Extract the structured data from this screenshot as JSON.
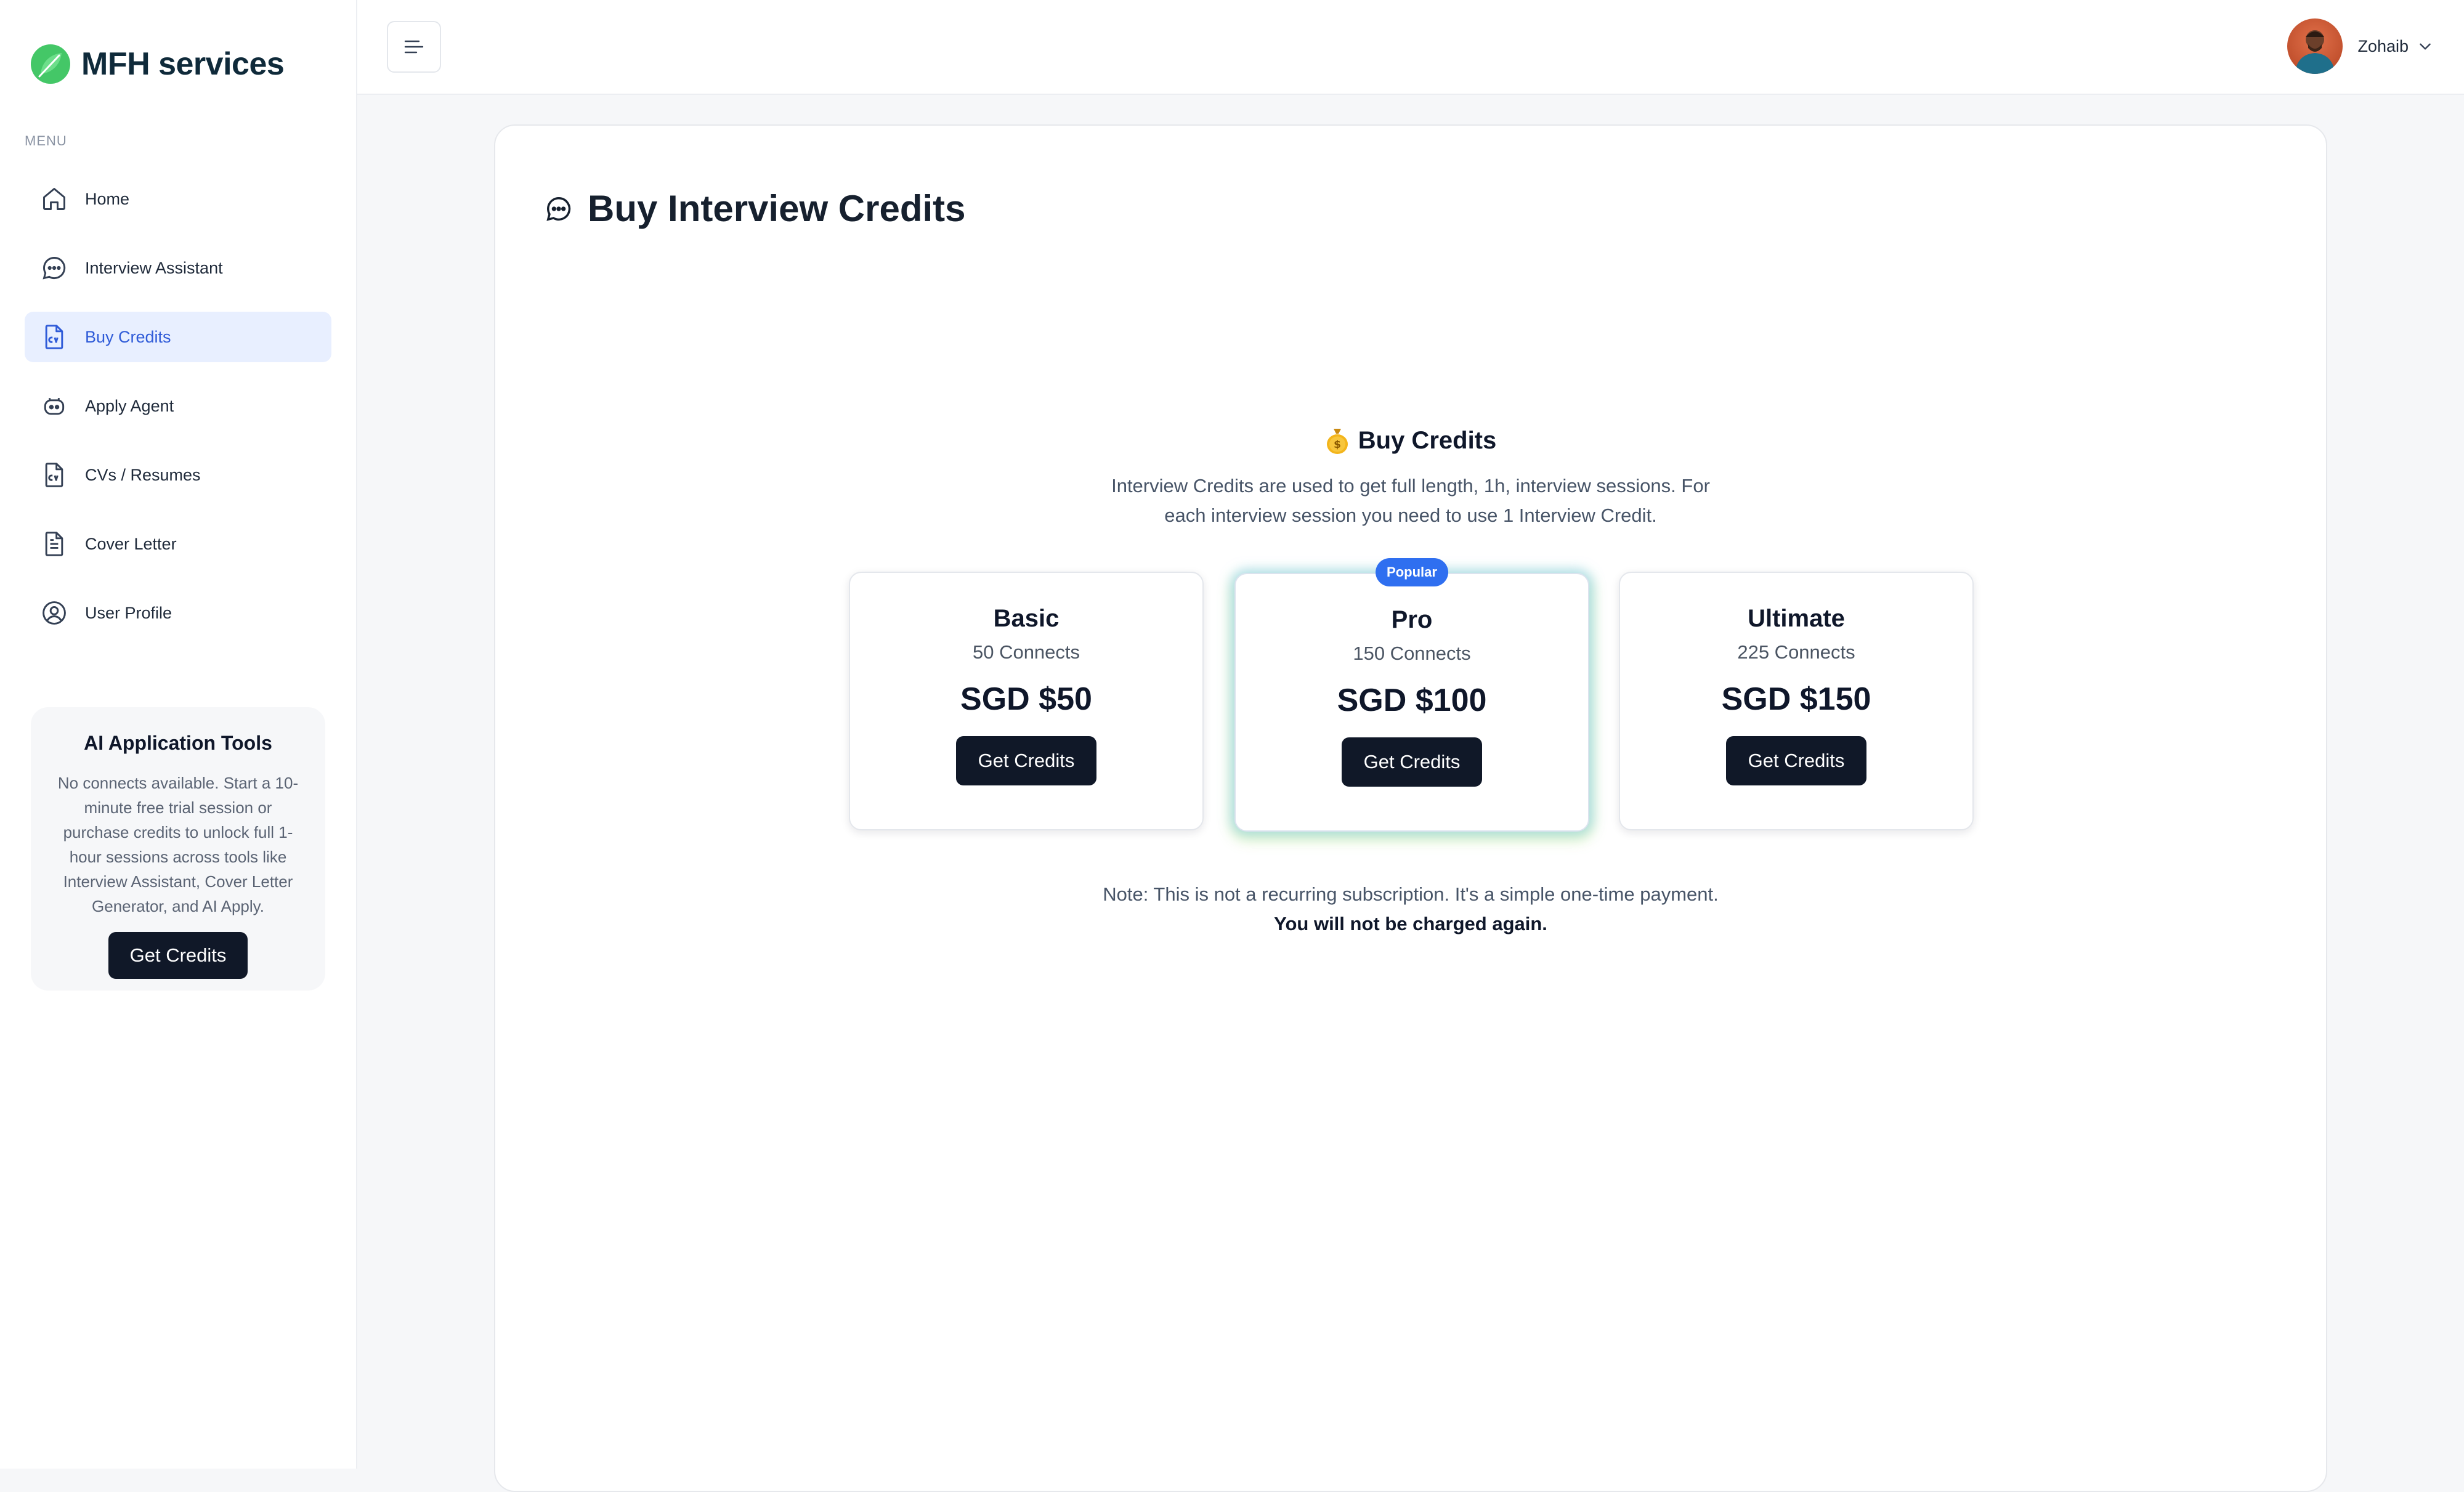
{
  "brand": {
    "name": "MFH services",
    "accent": "#3fb950"
  },
  "sidebar": {
    "menu_label": "MENU",
    "items": [
      {
        "label": "Home",
        "icon": "home-icon",
        "active": false
      },
      {
        "label": "Interview Assistant",
        "icon": "chat-bubble-icon",
        "active": false
      },
      {
        "label": "Buy Credits",
        "icon": "cv-document-icon",
        "active": true
      },
      {
        "label": "Apply Agent",
        "icon": "bot-icon",
        "active": false
      },
      {
        "label": "CVs / Resumes",
        "icon": "cv-document-icon",
        "active": false
      },
      {
        "label": "Cover Letter",
        "icon": "document-icon",
        "active": false
      },
      {
        "label": "User Profile",
        "icon": "user-circle-icon",
        "active": false
      }
    ],
    "tools_card": {
      "title": "AI Application Tools",
      "description": "No connects available. Start a 10-minute free trial session or purchase credits to unlock full 1-hour sessions across tools like Interview Assistant, Cover Letter Generator, and AI Apply.",
      "button_label": "Get Credits"
    }
  },
  "header": {
    "user_name": "Zohaib"
  },
  "main": {
    "page_title": "Buy Interview Credits",
    "section_title": "Buy Credits",
    "section_description": "Interview Credits are used to get full length, 1h, interview sessions. For each interview session you need to use 1 Interview Credit.",
    "plans": [
      {
        "name": "Basic",
        "connects": "50 Connects",
        "price": "SGD $50",
        "button_label": "Get Credits"
      },
      {
        "name": "Pro",
        "connects": "150 Connects",
        "price": "SGD $100",
        "button_label": "Get Credits",
        "badge": "Popular"
      },
      {
        "name": "Ultimate",
        "connects": "225 Connects",
        "price": "SGD $150",
        "button_label": "Get Credits"
      }
    ],
    "note": "Note: This is not a recurring subscription. It's a simple one-time payment.",
    "note_strong": "You will not be charged again."
  },
  "colors": {
    "active_nav_bg": "#e8efff",
    "active_nav_text": "#2f5bd8",
    "button_dark": "#101828",
    "badge_blue": "#2f6ff0"
  }
}
